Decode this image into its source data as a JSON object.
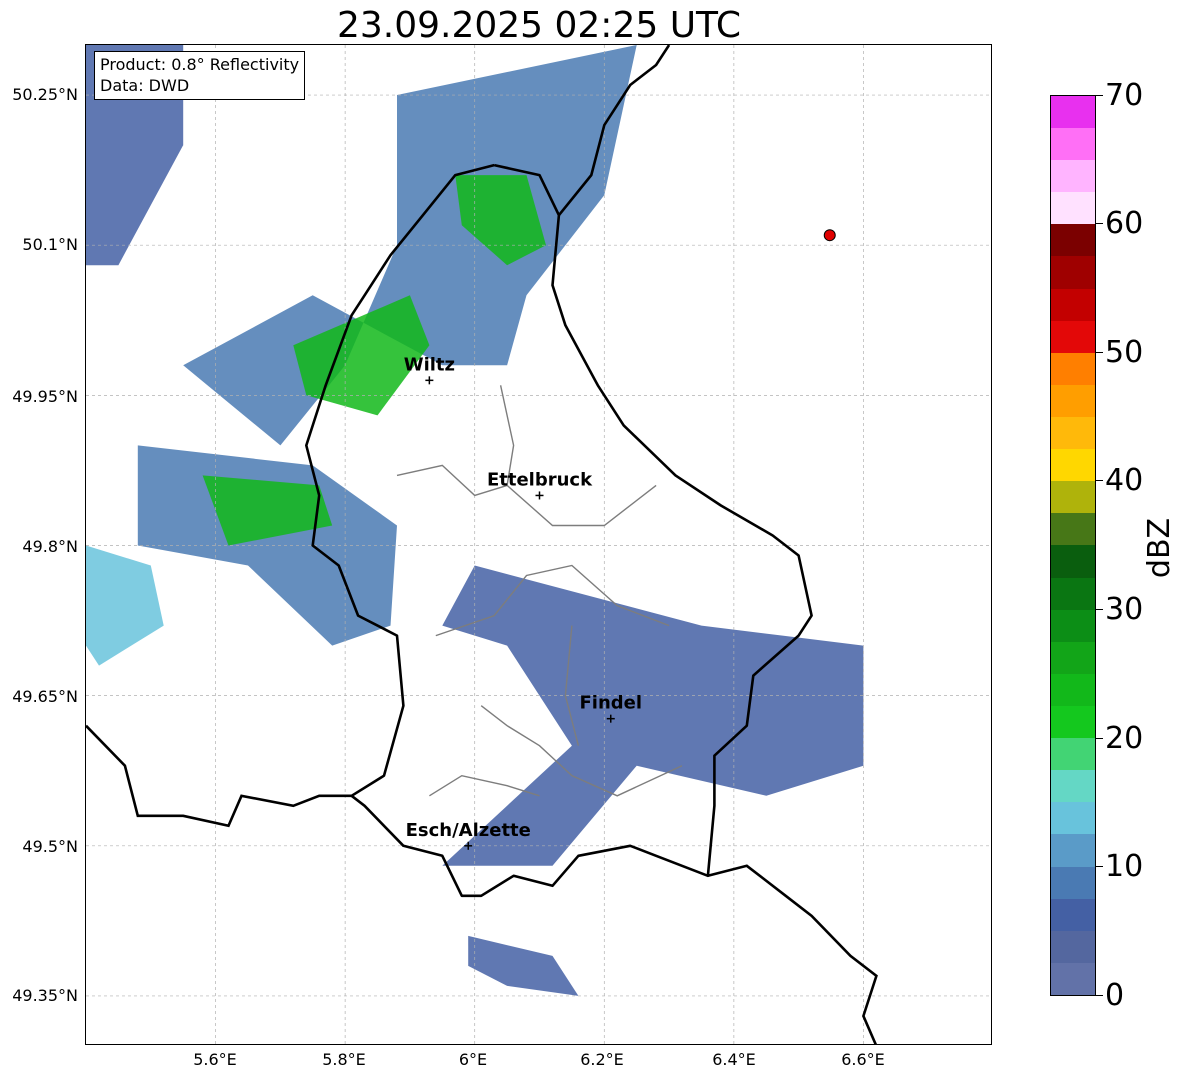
{
  "title": "23.09.2025 02:25 UTC",
  "info": {
    "product": "Product: 0.8° Reflectivity",
    "data": "Data: DWD"
  },
  "axes": {
    "lat_ticks": [
      "50.25°N",
      "50.1°N",
      "49.95°N",
      "49.8°N",
      "49.65°N",
      "49.5°N",
      "49.35°N"
    ],
    "lon_ticks": [
      "5.6°E",
      "5.8°E",
      "6°E",
      "6.2°E",
      "6.4°E",
      "6.6°E"
    ],
    "lat_range": [
      49.3,
      50.3
    ],
    "lon_range": [
      5.4,
      6.8
    ],
    "grid": true
  },
  "cities": [
    {
      "name": "Wiltz",
      "lon": 5.93,
      "lat": 49.965
    },
    {
      "name": "Ettelbruck",
      "lon": 6.1,
      "lat": 49.85
    },
    {
      "name": "Findel",
      "lon": 6.21,
      "lat": 49.627
    },
    {
      "name": "Esch/Alzette",
      "lon": 5.99,
      "lat": 49.5
    }
  ],
  "radar_site": {
    "lon": 6.548,
    "lat": 50.11,
    "color": "#e00000"
  },
  "colorbar": {
    "label": "dBZ",
    "ticks": [
      "0",
      "10",
      "20",
      "30",
      "40",
      "50",
      "60",
      "70"
    ],
    "min": 0,
    "max": 70,
    "step": 2.5,
    "colors": [
      "#6272a8",
      "#54679f",
      "#4460a4",
      "#4a7ab3",
      "#5a9bc8",
      "#68c3dc",
      "#64d7c5",
      "#42d474",
      "#14c81e",
      "#12b81a",
      "#12a518",
      "#0c8e16",
      "#0a7612",
      "#0a5e0e",
      "#477717",
      "#afb30b",
      "#ffd700",
      "#ffb90a",
      "#ff9e00",
      "#ff7f00",
      "#e30808",
      "#c30000",
      "#9f0000",
      "#7b0000",
      "#ffe1ff",
      "#ffb4ff",
      "#ff6ff6",
      "#e830ef"
    ]
  },
  "echo_regions": [
    {
      "name": "north-west",
      "points": [
        [
          5.4,
          50.3
        ],
        [
          5.55,
          50.3
        ],
        [
          5.55,
          50.2
        ],
        [
          5.45,
          50.08
        ],
        [
          5.4,
          50.08
        ]
      ],
      "level": 2
    },
    {
      "name": "north-east",
      "points": [
        [
          5.88,
          50.25
        ],
        [
          6.25,
          50.3
        ],
        [
          6.2,
          50.15
        ],
        [
          6.08,
          50.05
        ],
        [
          6.05,
          49.98
        ],
        [
          5.95,
          49.98
        ],
        [
          5.75,
          50.05
        ],
        [
          5.55,
          49.98
        ],
        [
          5.7,
          49.9
        ],
        [
          5.8,
          49.98
        ],
        [
          5.88,
          50.1
        ]
      ],
      "level": 3
    },
    {
      "name": "green-core-north",
      "points": [
        [
          5.72,
          50.0
        ],
        [
          5.9,
          50.05
        ],
        [
          5.93,
          50.0
        ],
        [
          5.85,
          49.93
        ],
        [
          5.74,
          49.95
        ]
      ],
      "level": 9
    },
    {
      "name": "green-core-east",
      "points": [
        [
          5.97,
          50.17
        ],
        [
          6.08,
          50.17
        ],
        [
          6.11,
          50.1
        ],
        [
          6.05,
          50.08
        ],
        [
          5.98,
          50.12
        ]
      ],
      "level": 9
    },
    {
      "name": "west-band",
      "points": [
        [
          5.48,
          49.9
        ],
        [
          5.75,
          49.88
        ],
        [
          5.88,
          49.82
        ],
        [
          5.87,
          49.72
        ],
        [
          5.78,
          49.7
        ],
        [
          5.65,
          49.78
        ],
        [
          5.48,
          49.8
        ]
      ],
      "level": 3
    },
    {
      "name": "green-core-west",
      "points": [
        [
          5.58,
          49.87
        ],
        [
          5.76,
          49.86
        ],
        [
          5.78,
          49.82
        ],
        [
          5.62,
          49.8
        ]
      ],
      "level": 9
    },
    {
      "name": "south-east",
      "points": [
        [
          6.0,
          49.78
        ],
        [
          6.35,
          49.72
        ],
        [
          6.6,
          49.7
        ],
        [
          6.6,
          49.58
        ],
        [
          6.45,
          49.55
        ],
        [
          6.25,
          49.58
        ],
        [
          6.12,
          49.48
        ],
        [
          5.95,
          49.48
        ],
        [
          6.15,
          49.6
        ],
        [
          6.05,
          49.7
        ],
        [
          5.95,
          49.72
        ]
      ],
      "level": 2
    },
    {
      "name": "far-west",
      "points": [
        [
          5.4,
          49.8
        ],
        [
          5.5,
          49.78
        ],
        [
          5.52,
          49.72
        ],
        [
          5.42,
          49.68
        ],
        [
          5.4,
          49.7
        ]
      ],
      "level": 5
    },
    {
      "name": "south-small",
      "points": [
        [
          5.99,
          49.41
        ],
        [
          6.12,
          49.39
        ],
        [
          6.16,
          49.35
        ],
        [
          6.05,
          49.36
        ],
        [
          5.99,
          49.38
        ]
      ],
      "level": 2
    }
  ]
}
